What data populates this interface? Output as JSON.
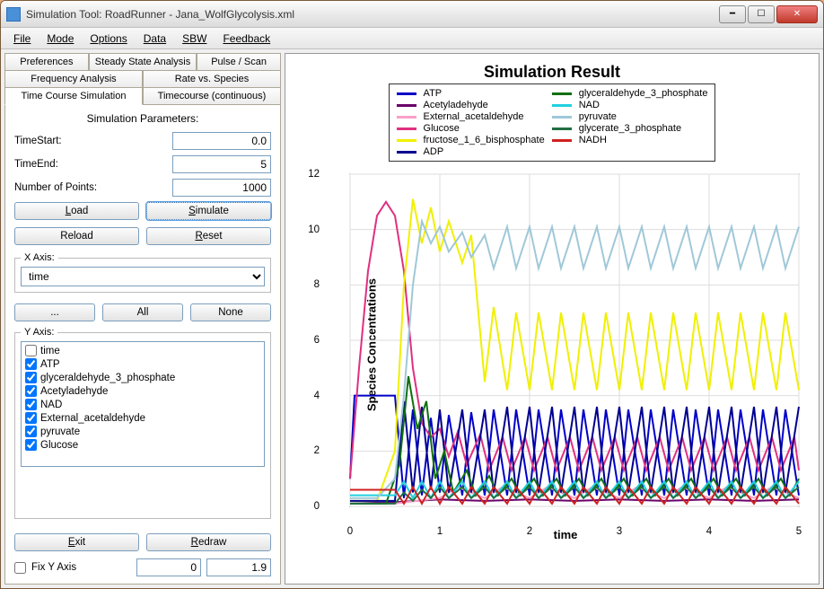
{
  "window": {
    "title": "Simulation Tool: RoadRunner - Jana_WolfGlycolysis.xml"
  },
  "menubar": [
    "File",
    "Mode",
    "Options",
    "Data",
    "SBW",
    "Feedback"
  ],
  "tabs": {
    "row1": [
      "Preferences",
      "Steady State Analysis",
      "Pulse / Scan"
    ],
    "row2": [
      "Frequency Analysis",
      "Rate vs. Species"
    ],
    "row3": [
      "Time Course Simulation",
      "Timecourse (continuous)"
    ],
    "active": "Time Course Simulation"
  },
  "panel": {
    "paramsLabel": "Simulation Parameters:",
    "timeStartLabel": "TimeStart:",
    "timeStartValue": "0.0",
    "timeEndLabel": "TimeEnd:",
    "timeEndValue": "5",
    "numPointsLabel": "Number of Points:",
    "numPointsValue": "1000",
    "loadBtn": "Load",
    "simulateBtn": "Simulate",
    "reloadBtn": "Reload",
    "resetBtn": "Reset",
    "xAxisLabel": "X Axis:",
    "xAxisValue": "time",
    "ellipsisBtn": "...",
    "allBtn": "All",
    "noneBtn": "None",
    "yAxisLabel": "Y Axis:",
    "yAxisItems": [
      {
        "label": "time",
        "checked": false
      },
      {
        "label": "ATP",
        "checked": true
      },
      {
        "label": "glyceraldehyde_3_phosphate",
        "checked": true
      },
      {
        "label": "Acetyladehyde",
        "checked": true
      },
      {
        "label": "NAD",
        "checked": true
      },
      {
        "label": "External_acetaldehyde",
        "checked": true
      },
      {
        "label": "pyruvate",
        "checked": true
      },
      {
        "label": "Glucose",
        "checked": true
      }
    ],
    "exitBtn": "Exit",
    "redrawBtn": "Redraw",
    "fixYLabel": "Fix Y Axis",
    "fixYMin": "0",
    "fixYMax": "1.9"
  },
  "chart_data": {
    "type": "line",
    "title": "Simulation Result",
    "xlabel": "time",
    "ylabel": "Species Concentrations",
    "xlim": [
      0,
      5
    ],
    "ylim": [
      0,
      12
    ],
    "xticks": [
      0,
      1,
      2,
      3,
      4,
      5
    ],
    "yticks": [
      0,
      2,
      4,
      6,
      8,
      10,
      12
    ],
    "series": [
      {
        "name": "ATP",
        "color": "#0000c8",
        "x": [
          0,
          0.05,
          0.1,
          0.5,
          0.6,
          0.7,
          0.8,
          0.9,
          1.0,
          1.1,
          1.25,
          1.35,
          1.5,
          1.6,
          1.75,
          1.85,
          2.0,
          2.1,
          2.25,
          2.35,
          2.5,
          2.6,
          2.75,
          2.85,
          3.0,
          3.1,
          3.25,
          3.35,
          3.5,
          3.6,
          3.75,
          3.85,
          4.0,
          4.1,
          4.25,
          4.35,
          4.5,
          4.6,
          4.75,
          4.85,
          5.0
        ],
        "y": [
          1.0,
          4.0,
          4.0,
          4.0,
          0.3,
          3.5,
          0.4,
          3.2,
          0.5,
          3.3,
          0.4,
          3.4,
          0.4,
          3.5,
          0.4,
          3.5,
          0.4,
          3.5,
          0.4,
          3.5,
          0.4,
          3.5,
          0.4,
          3.5,
          0.4,
          3.5,
          0.4,
          3.5,
          0.4,
          3.5,
          0.4,
          3.5,
          0.4,
          3.5,
          0.4,
          3.5,
          0.4,
          3.5,
          0.4,
          3.5,
          0.4
        ]
      },
      {
        "name": "Acetyladehyde",
        "color": "#6a006a",
        "x": [
          0,
          0.5,
          1,
          1.5,
          2,
          2.5,
          3,
          3.5,
          4,
          4.5,
          5
        ],
        "y": [
          0.1,
          0.15,
          0.25,
          0.2,
          0.25,
          0.2,
          0.25,
          0.2,
          0.25,
          0.2,
          0.25
        ]
      },
      {
        "name": "External_acetaldehyde",
        "color": "#f8a0c8",
        "x": [
          0,
          0.5,
          1,
          1.2,
          1.5,
          1.7,
          2,
          2.2,
          2.5,
          2.7,
          3,
          3.2,
          3.5,
          3.7,
          4,
          4.2,
          4.5,
          4.7,
          5
        ],
        "y": [
          0.1,
          0.1,
          0.3,
          0.7,
          0.3,
          0.7,
          0.3,
          0.7,
          0.3,
          0.7,
          0.3,
          0.7,
          0.3,
          0.7,
          0.3,
          0.7,
          0.3,
          0.7,
          0.3
        ]
      },
      {
        "name": "Glucose",
        "color": "#e03080",
        "x": [
          0,
          0.1,
          0.2,
          0.3,
          0.4,
          0.5,
          0.6,
          0.7,
          0.8,
          0.9,
          1.0,
          1.1,
          1.2,
          1.3,
          1.45,
          1.55,
          1.7,
          1.8,
          1.95,
          2.05,
          2.2,
          2.3,
          2.45,
          2.55,
          2.7,
          2.8,
          2.95,
          3.05,
          3.2,
          3.3,
          3.45,
          3.55,
          3.7,
          3.8,
          3.95,
          4.05,
          4.2,
          4.3,
          4.45,
          4.55,
          4.7,
          4.8,
          4.95,
          5
        ],
        "y": [
          1.0,
          5.0,
          8.5,
          10.5,
          11.0,
          10.5,
          8.5,
          5.0,
          3.0,
          2.5,
          2.8,
          1.8,
          2.7,
          1.5,
          2.6,
          1.3,
          2.5,
          1.3,
          2.5,
          1.3,
          2.5,
          1.3,
          2.5,
          1.3,
          2.5,
          1.3,
          2.5,
          1.3,
          2.5,
          1.3,
          2.5,
          1.3,
          2.5,
          1.3,
          2.5,
          1.3,
          2.5,
          1.3,
          2.5,
          1.3,
          2.5,
          1.3,
          2.5,
          1.3
        ]
      },
      {
        "name": "fructose_1_6_bisphosphate",
        "color": "#f0f000",
        "x": [
          0,
          0.3,
          0.5,
          0.6,
          0.7,
          0.8,
          0.9,
          1.0,
          1.1,
          1.25,
          1.35,
          1.5,
          1.6,
          1.75,
          1.85,
          2.0,
          2.1,
          2.25,
          2.35,
          2.5,
          2.6,
          2.75,
          2.85,
          3.0,
          3.1,
          3.25,
          3.35,
          3.5,
          3.6,
          3.75,
          3.85,
          4.0,
          4.1,
          4.25,
          4.35,
          4.5,
          4.6,
          4.75,
          4.85,
          5.0
        ],
        "y": [
          0.2,
          0.2,
          2.0,
          8.0,
          11.1,
          9.5,
          10.8,
          9.2,
          10.3,
          8.8,
          9.8,
          4.5,
          7.2,
          4.2,
          7.0,
          4.2,
          7.0,
          4.2,
          7.0,
          4.2,
          7.0,
          4.2,
          7.0,
          4.2,
          7.0,
          4.2,
          7.0,
          4.2,
          7.0,
          4.2,
          7.0,
          4.2,
          7.0,
          4.2,
          7.0,
          4.2,
          7.0,
          4.2,
          7.0,
          4.2
        ]
      },
      {
        "name": "ADP",
        "color": "#000090",
        "x": [
          0,
          0.5,
          0.6,
          0.7,
          0.8,
          0.9,
          1.0,
          1.1,
          1.25,
          1.35,
          1.5,
          1.6,
          1.75,
          1.85,
          2.0,
          2.1,
          2.25,
          2.35,
          2.5,
          2.6,
          2.75,
          2.85,
          3.0,
          3.1,
          3.25,
          3.35,
          3.5,
          3.6,
          3.75,
          3.85,
          4.0,
          4.1,
          4.25,
          4.35,
          4.5,
          4.6,
          4.75,
          4.85,
          5.0
        ],
        "y": [
          0.2,
          0.2,
          3.8,
          0.5,
          3.6,
          0.6,
          3.5,
          0.5,
          3.5,
          0.5,
          3.5,
          0.5,
          3.6,
          0.5,
          3.6,
          0.5,
          3.6,
          0.5,
          3.6,
          0.5,
          3.6,
          0.5,
          3.6,
          0.5,
          3.6,
          0.5,
          3.6,
          0.5,
          3.6,
          0.5,
          3.6,
          0.5,
          3.6,
          0.5,
          3.6,
          0.5,
          3.6,
          0.5,
          3.6
        ]
      },
      {
        "name": "glyceraldehyde_3_phosphate",
        "color": "#107010",
        "x": [
          0,
          0.4,
          0.55,
          0.65,
          0.75,
          0.85,
          0.95,
          1.05,
          1.15,
          1.3,
          1.4,
          1.55,
          1.65,
          1.8,
          1.9,
          2.05,
          2.15,
          2.3,
          2.4,
          2.55,
          2.65,
          2.8,
          2.9,
          3.05,
          3.15,
          3.3,
          3.4,
          3.55,
          3.65,
          3.8,
          3.9,
          4.05,
          4.15,
          4.3,
          4.4,
          4.55,
          4.65,
          4.8,
          4.9,
          5
        ],
        "y": [
          0.1,
          0.1,
          1.5,
          4.7,
          2.8,
          3.8,
          1.0,
          2.0,
          0.5,
          1.3,
          0.4,
          1.1,
          0.4,
          1.0,
          0.4,
          1.0,
          0.4,
          1.0,
          0.4,
          1.0,
          0.4,
          1.0,
          0.4,
          1.0,
          0.4,
          1.0,
          0.4,
          1.0,
          0.4,
          1.0,
          0.4,
          1.0,
          0.4,
          1.0,
          0.4,
          1.0,
          0.4,
          1.0,
          0.4,
          1.0
        ]
      },
      {
        "name": "NAD",
        "color": "#20d0e0",
        "x": [
          0,
          0.5,
          0.6,
          0.7,
          0.8,
          0.9,
          1,
          1.1,
          1.25,
          1.35,
          1.5,
          1.6,
          1.75,
          1.85,
          2,
          2.1,
          2.25,
          2.35,
          2.5,
          2.6,
          2.75,
          2.85,
          3,
          3.1,
          3.25,
          3.35,
          3.5,
          3.6,
          3.75,
          3.85,
          4,
          4.1,
          4.25,
          4.35,
          4.5,
          4.6,
          4.75,
          4.85,
          5
        ],
        "y": [
          0.4,
          0.4,
          0.9,
          0.3,
          0.9,
          0.3,
          0.9,
          0.3,
          0.9,
          0.3,
          0.9,
          0.3,
          0.9,
          0.3,
          0.9,
          0.3,
          0.9,
          0.3,
          0.9,
          0.3,
          0.9,
          0.3,
          0.9,
          0.3,
          0.9,
          0.3,
          0.9,
          0.3,
          0.9,
          0.3,
          0.9,
          0.3,
          0.9,
          0.3,
          0.9,
          0.3,
          0.9,
          0.3,
          0.9
        ]
      },
      {
        "name": "pyruvate",
        "color": "#a0c8d8",
        "x": [
          0,
          0.3,
          0.5,
          0.6,
          0.7,
          0.8,
          0.9,
          1.0,
          1.1,
          1.25,
          1.35,
          1.5,
          1.6,
          1.75,
          1.85,
          2.0,
          2.1,
          2.25,
          2.35,
          2.5,
          2.6,
          2.75,
          2.85,
          3.0,
          3.1,
          3.25,
          3.35,
          3.5,
          3.6,
          3.75,
          3.85,
          4.0,
          4.1,
          4.25,
          4.35,
          4.5,
          4.6,
          4.75,
          4.85,
          5.0
        ],
        "y": [
          0.3,
          0.3,
          1.0,
          4.0,
          8.0,
          10.3,
          9.5,
          10.1,
          9.2,
          9.9,
          9.0,
          9.8,
          8.6,
          10.1,
          8.6,
          10.1,
          8.6,
          10.1,
          8.6,
          10.1,
          8.6,
          10.1,
          8.6,
          10.1,
          8.6,
          10.1,
          8.6,
          10.1,
          8.6,
          10.1,
          8.6,
          10.1,
          8.6,
          10.1,
          8.6,
          10.1,
          8.6,
          10.1,
          8.6,
          10.1
        ]
      },
      {
        "name": "glycerate_3_phosphate",
        "color": "#207040",
        "x": [
          0,
          0.5,
          0.6,
          0.7,
          0.8,
          0.9,
          1,
          1.1,
          1.25,
          1.35,
          1.5,
          1.6,
          1.75,
          1.85,
          2,
          2.1,
          2.25,
          2.35,
          2.5,
          2.6,
          2.75,
          2.85,
          3,
          3.1,
          3.25,
          3.35,
          3.5,
          3.6,
          3.75,
          3.85,
          4,
          4.1,
          4.25,
          4.35,
          4.5,
          4.6,
          4.75,
          4.85,
          5
        ],
        "y": [
          0.1,
          0.1,
          0.5,
          0.2,
          0.6,
          0.3,
          0.7,
          0.3,
          0.7,
          0.3,
          0.7,
          0.3,
          0.7,
          0.3,
          0.7,
          0.3,
          0.7,
          0.3,
          0.7,
          0.3,
          0.7,
          0.3,
          0.7,
          0.3,
          0.7,
          0.3,
          0.7,
          0.3,
          0.7,
          0.3,
          0.7,
          0.3,
          0.7,
          0.3,
          0.7,
          0.3,
          0.7,
          0.3,
          0.7
        ]
      },
      {
        "name": "NADH",
        "color": "#d02020",
        "x": [
          0,
          0.5,
          0.6,
          0.7,
          0.8,
          0.9,
          1,
          1.1,
          1.25,
          1.35,
          1.5,
          1.6,
          1.75,
          1.85,
          2,
          2.1,
          2.25,
          2.35,
          2.5,
          2.6,
          2.75,
          2.85,
          3,
          3.1,
          3.25,
          3.35,
          3.5,
          3.6,
          3.75,
          3.85,
          4,
          4.1,
          4.25,
          4.35,
          4.5,
          4.6,
          4.75,
          4.85,
          5
        ],
        "y": [
          0.6,
          0.6,
          0.1,
          0.7,
          0.1,
          0.7,
          0.1,
          0.7,
          0.1,
          0.7,
          0.1,
          0.7,
          0.1,
          0.7,
          0.1,
          0.7,
          0.1,
          0.7,
          0.1,
          0.7,
          0.1,
          0.7,
          0.1,
          0.7,
          0.1,
          0.7,
          0.1,
          0.7,
          0.1,
          0.7,
          0.1,
          0.7,
          0.1,
          0.7,
          0.1,
          0.7,
          0.1,
          0.7,
          0.1
        ]
      }
    ]
  }
}
